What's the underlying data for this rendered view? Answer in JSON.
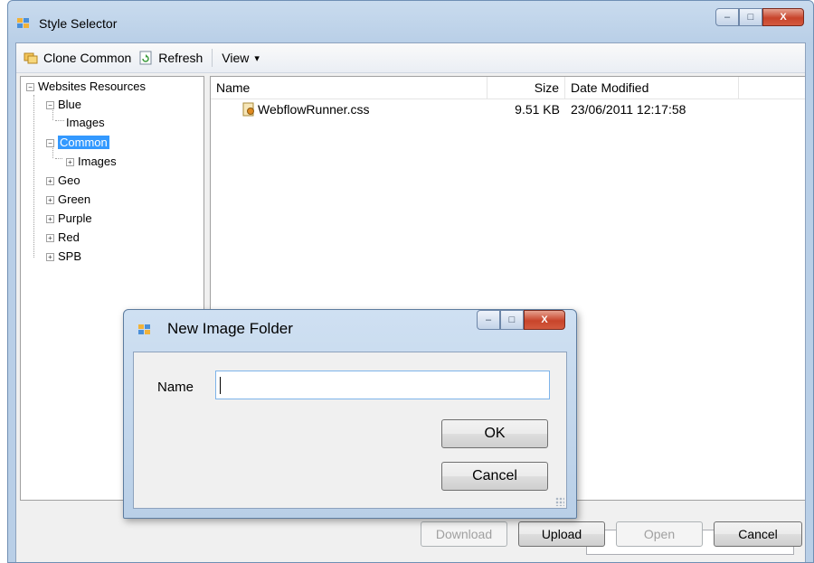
{
  "window": {
    "title": "Style Selector",
    "controls": [
      "–",
      "□",
      "X"
    ]
  },
  "toolbar": {
    "clone_label": "Clone Common",
    "refresh_label": "Refresh",
    "view_label": "View",
    "view_arrow": "▾"
  },
  "tree": {
    "root": "Websites Resources",
    "nodes": [
      "Blue",
      "Images",
      "Common",
      "Images",
      "Geo",
      "Green",
      "Purple",
      "Red",
      "SPB"
    ],
    "toggles": {
      "expanded": "−",
      "collapsed": "+"
    }
  },
  "list": {
    "columns": [
      "Name",
      "Size",
      "Date Modified"
    ],
    "rows": [
      {
        "name": "WebflowRunner.css",
        "size": "9.51 KB",
        "date": "23/06/2011 12:17:58"
      }
    ]
  },
  "buttons": {
    "download": "Download",
    "upload": "Upload",
    "open": "Open",
    "cancel": "Cancel"
  },
  "dialog": {
    "title": "New Image Folder",
    "controls": [
      "–",
      "□",
      "X"
    ],
    "name_label": "Name",
    "name_value": "",
    "ok_label": "OK",
    "cancel_label": "Cancel"
  },
  "colors": {
    "selection": "#3399ff",
    "close_button": "#c8442b",
    "frame": "#b9cfe7"
  }
}
